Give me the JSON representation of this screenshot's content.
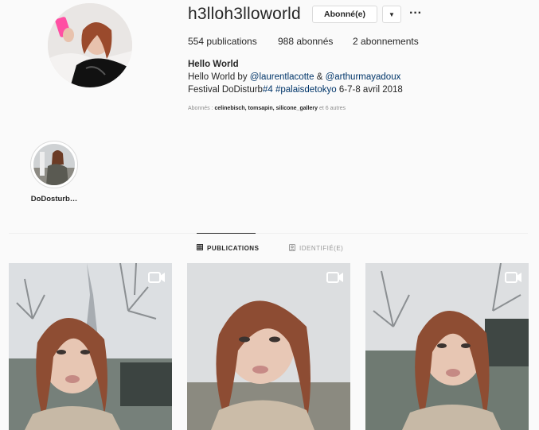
{
  "profile": {
    "username": "h3lloh3lloworld",
    "follow_button": "Abonné(e)",
    "dropdown_icon": "triangle-down-icon",
    "more_icon": "ellipsis-icon",
    "stats": {
      "posts": "554 publications",
      "followers": "988 abonnés",
      "following": "2 abonnements"
    },
    "bio": {
      "name": "Hello World",
      "line2_prefix": "Hello World by ",
      "mention1": "@laurentlacotte",
      "line2_sep": " & ",
      "mention2": "@arthurmayadoux",
      "line3_prefix": "Festival DoDisturb",
      "hashtag1": "#4",
      "line3_space": " ",
      "hashtag2": "#palaisdetokyo",
      "line3_suffix": " 6-7-8 avril 2018"
    },
    "followed_by": {
      "prefix": "Abonnés : ",
      "names": "celinebisch, tomsapin, silicone_gallery",
      "suffix": " et 6 autres"
    }
  },
  "highlights": [
    {
      "label": "DoDosturb…"
    }
  ],
  "tabs": [
    {
      "label": "PUBLICATIONS",
      "icon": "grid-icon",
      "active": true
    },
    {
      "label": "IDENTIFIÉ(E)",
      "icon": "tag-icon",
      "active": false
    }
  ],
  "posts": [
    {
      "type": "video",
      "icon": "video-camera-icon"
    },
    {
      "type": "video",
      "icon": "video-camera-icon"
    },
    {
      "type": "video",
      "icon": "video-camera-icon"
    }
  ],
  "colors": {
    "link": "#003569",
    "text": "#262626",
    "muted": "#8e8e8e",
    "background": "#fafafa"
  }
}
